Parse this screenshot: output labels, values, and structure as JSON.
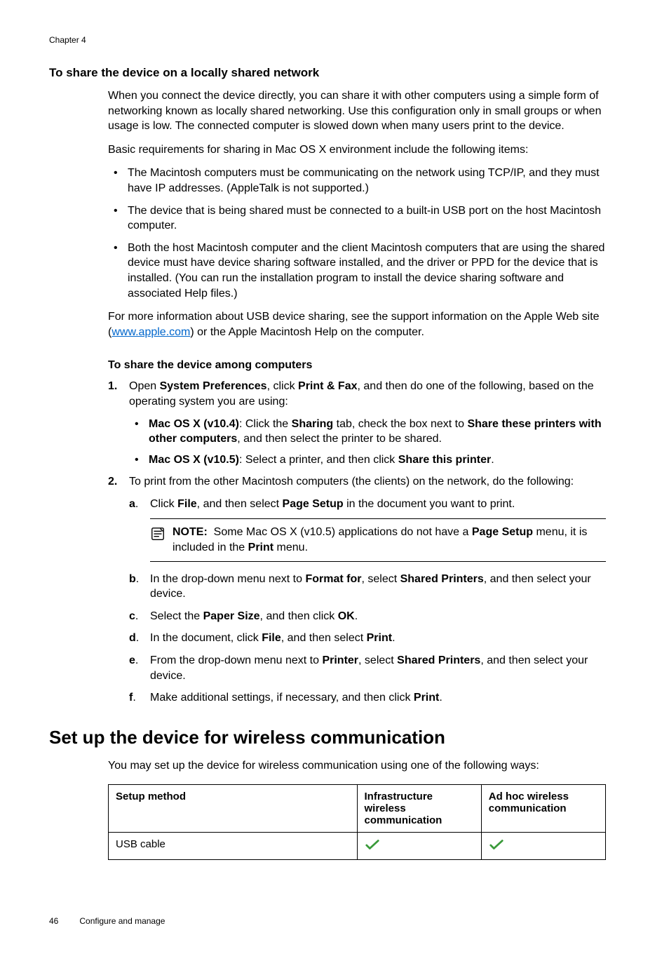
{
  "chapter": "Chapter 4",
  "section_heading": "To share the device on a locally shared network",
  "intro_p1": "When you connect the device directly, you can share it with other computers using a simple form of networking known as locally shared networking. Use this configuration only in small groups or when usage is low. The connected computer is slowed down when many users print to the device.",
  "intro_p2": "Basic requirements for sharing in Mac OS X environment include the following items:",
  "bullets": [
    "The Macintosh computers must be communicating on the network using TCP/IP, and they must have IP addresses. (AppleTalk is not supported.)",
    "The device that is being shared must be connected to a built-in USB port on the host Macintosh computer.",
    "Both the host Macintosh computer and the client Macintosh computers that are using the shared device must have device sharing software installed, and the driver or PPD for the device that is installed. (You can run the installation program to install the device sharing software and associated Help files.)"
  ],
  "more_info_pre": "For more information about USB device sharing, see the support information on the Apple Web site (",
  "more_info_link": "www.apple.com",
  "more_info_post": ") or the Apple Macintosh Help on the computer.",
  "share_heading": "To share the device among computers",
  "step1_num": "1.",
  "step1_pre": "Open ",
  "step1_b1": "System Preferences",
  "step1_mid1": ", click ",
  "step1_b2": "Print & Fax",
  "step1_post": ", and then do one of the following, based on the operating system you are using:",
  "step1_bullet1_b1": "Mac OS X (v10.4)",
  "step1_bullet1_mid1": ": Click the ",
  "step1_bullet1_b2": "Sharing",
  "step1_bullet1_mid2": " tab, check the box next to ",
  "step1_bullet1_b3": "Share these printers with other computers",
  "step1_bullet1_post": ", and then select the printer to be shared.",
  "step1_bullet2_b1": "Mac OS X (v10.5)",
  "step1_bullet2_mid": ": Select a printer, and then click ",
  "step1_bullet2_b2": "Share this printer",
  "step1_bullet2_post": ".",
  "step2_num": "2.",
  "step2_text": "To print from the other Macintosh computers (the clients) on the network, do the following:",
  "sub_a_letter": "a",
  "sub_a_period": ".",
  "sub_a_pre": "Click ",
  "sub_a_b1": "File",
  "sub_a_mid": ", and then select ",
  "sub_a_b2": "Page Setup",
  "sub_a_post": " in the document you want to print.",
  "note_label": "NOTE:",
  "note_pre": "Some Mac OS X (v10.5) applications do not have a ",
  "note_b1": "Page Setup",
  "note_mid": " menu, it is included in the ",
  "note_b2": "Print",
  "note_post": " menu.",
  "sub_b_letter": "b",
  "sub_b_pre": "In the drop-down menu next to ",
  "sub_b_b1": "Format for",
  "sub_b_mid": ", select ",
  "sub_b_b2": "Shared Printers",
  "sub_b_post": ", and then select your device.",
  "sub_c_letter": "c",
  "sub_c_pre": "Select the ",
  "sub_c_b1": "Paper Size",
  "sub_c_mid": ", and then click ",
  "sub_c_b2": "OK",
  "sub_c_post": ".",
  "sub_d_letter": "d",
  "sub_d_pre": "In the document, click ",
  "sub_d_b1": "File",
  "sub_d_mid": ", and then select ",
  "sub_d_b2": "Print",
  "sub_d_post": ".",
  "sub_e_letter": "e",
  "sub_e_pre": "From the drop-down menu next to ",
  "sub_e_b1": "Printer",
  "sub_e_mid": ", select ",
  "sub_e_b2": "Shared Printers",
  "sub_e_post": ", and then select your device.",
  "sub_f_letter": "f",
  "sub_f_pre": "Make additional settings, if necessary, and then click ",
  "sub_f_b1": "Print",
  "sub_f_post": ".",
  "main_heading": "Set up the device for wireless communication",
  "wireless_intro": "You may set up the device for wireless communication using one of the following ways:",
  "table": {
    "h1": "Setup method",
    "h2": "Infrastructure wireless communication",
    "h3": "Ad hoc wireless communication",
    "r1c1": "USB cable"
  },
  "footer_page": "46",
  "footer_title": "Configure and manage"
}
